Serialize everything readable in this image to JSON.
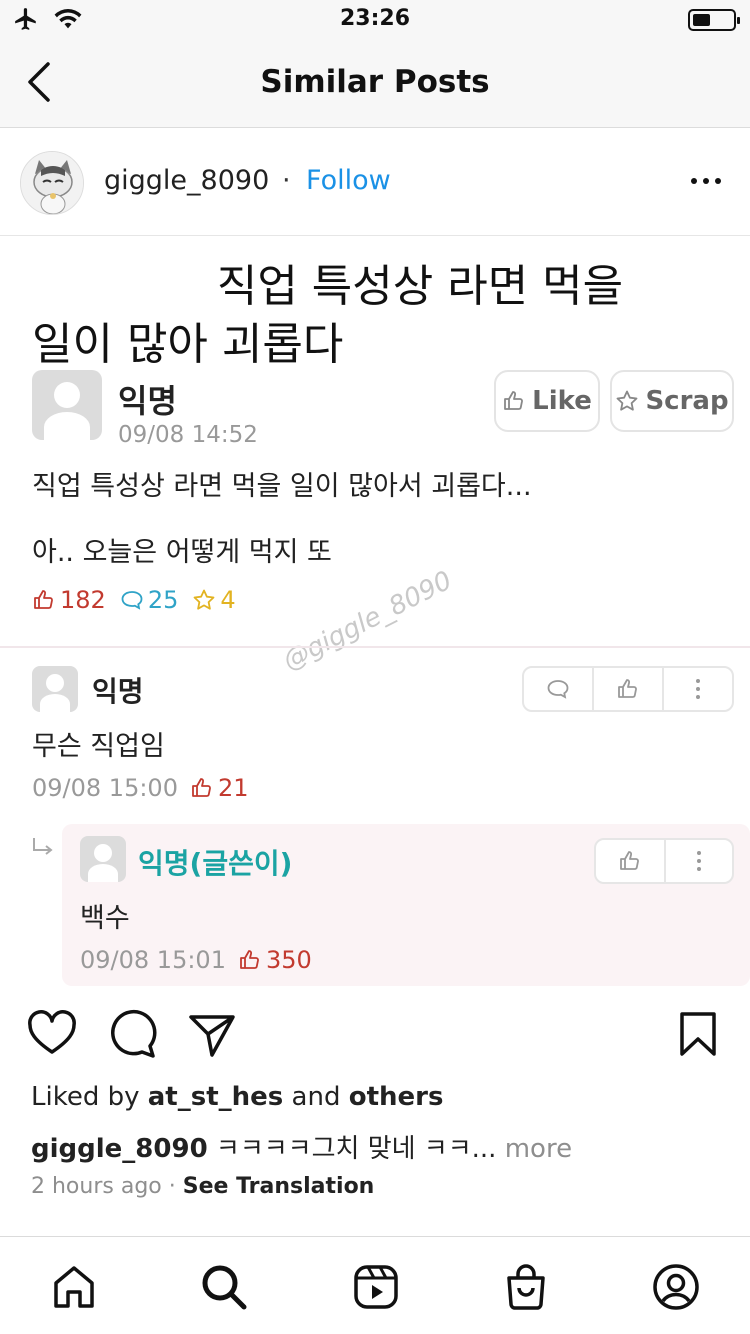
{
  "status_bar": {
    "time": "23:26",
    "battery_level": 0.45
  },
  "nav": {
    "title": "Similar Posts"
  },
  "post": {
    "username": "giggle_8090",
    "separator": "·",
    "follow_label": "Follow"
  },
  "image": {
    "title_line1": "직업 특성상 라면 먹을",
    "title_line2": "일이 많아 괴롭다",
    "op": {
      "name": "익명",
      "date": "09/08 14:52",
      "like_label": "Like",
      "scrap_label": "Scrap",
      "body_line1": "직업 특성상 라면 먹을 일이 많아서 괴롭다...",
      "body_line2": "아.. 오늘은 어떻게 먹지 또",
      "likes": "182",
      "comments": "25",
      "scraps": "4"
    },
    "watermark": "@giggle_8090",
    "comment1": {
      "name": "익명",
      "text": "무슨 직업임",
      "date": "09/08 15:00",
      "likes": "21"
    },
    "reply": {
      "name": "익명(글쓴이)",
      "text": "백수",
      "date": "09/08 15:01",
      "likes": "350"
    }
  },
  "engagement": {
    "liked_prefix": "Liked by ",
    "liked_user": "at_st_hes",
    "liked_and": " and ",
    "liked_others": "others",
    "caption_user": "giggle_8090",
    "caption_text": " ㅋㅋㅋㅋ그치 맞네 ㅋㅋ...",
    "caption_more": " more",
    "time_ago": "2 hours ago",
    "dot": " · ",
    "see_translation": "See Translation"
  },
  "tabs": [
    "home-icon",
    "search-icon",
    "reels-icon",
    "shop-icon",
    "profile-icon"
  ],
  "colors": {
    "accent_blue": "#1a91e6",
    "reply_name_teal": "#1ba3a3",
    "like_red": "#c23a2f",
    "comment_blue": "#2fa3c7",
    "scrap_yellow": "#e2b321"
  }
}
